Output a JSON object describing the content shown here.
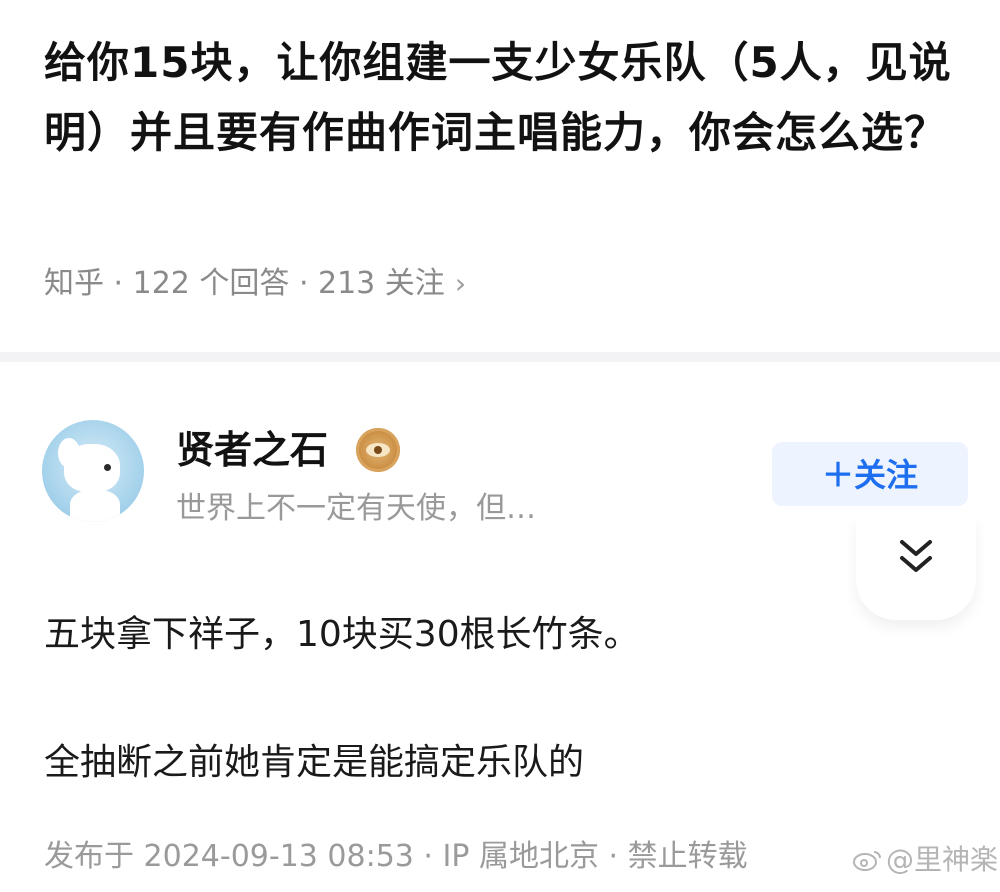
{
  "question": {
    "title": "给你15块，让你组建一支少女乐队（5人，见说明）并且要有作曲作词主唱能力，你会怎么选？",
    "meta": "知乎 · 122 个回答 · 213 关注",
    "meta_chevron": "›"
  },
  "answer": {
    "author_name": "贤者之石",
    "author_bio": "世界上不一定有天使，但…",
    "follow_label": "＋关注",
    "paragraphs": [
      "五块拿下祥子，10块买30根长竹条。",
      "全抽断之前她肯定是能搞定乐队的"
    ],
    "footer": "发布于 2024-09-13 08:53 · IP 属地北京 · 禁止转载"
  },
  "watermark": {
    "text": "@里神楽"
  },
  "colors": {
    "accent": "#1e6ff0",
    "follow_bg": "#eef4ff",
    "muted": "#9a9a9a"
  }
}
